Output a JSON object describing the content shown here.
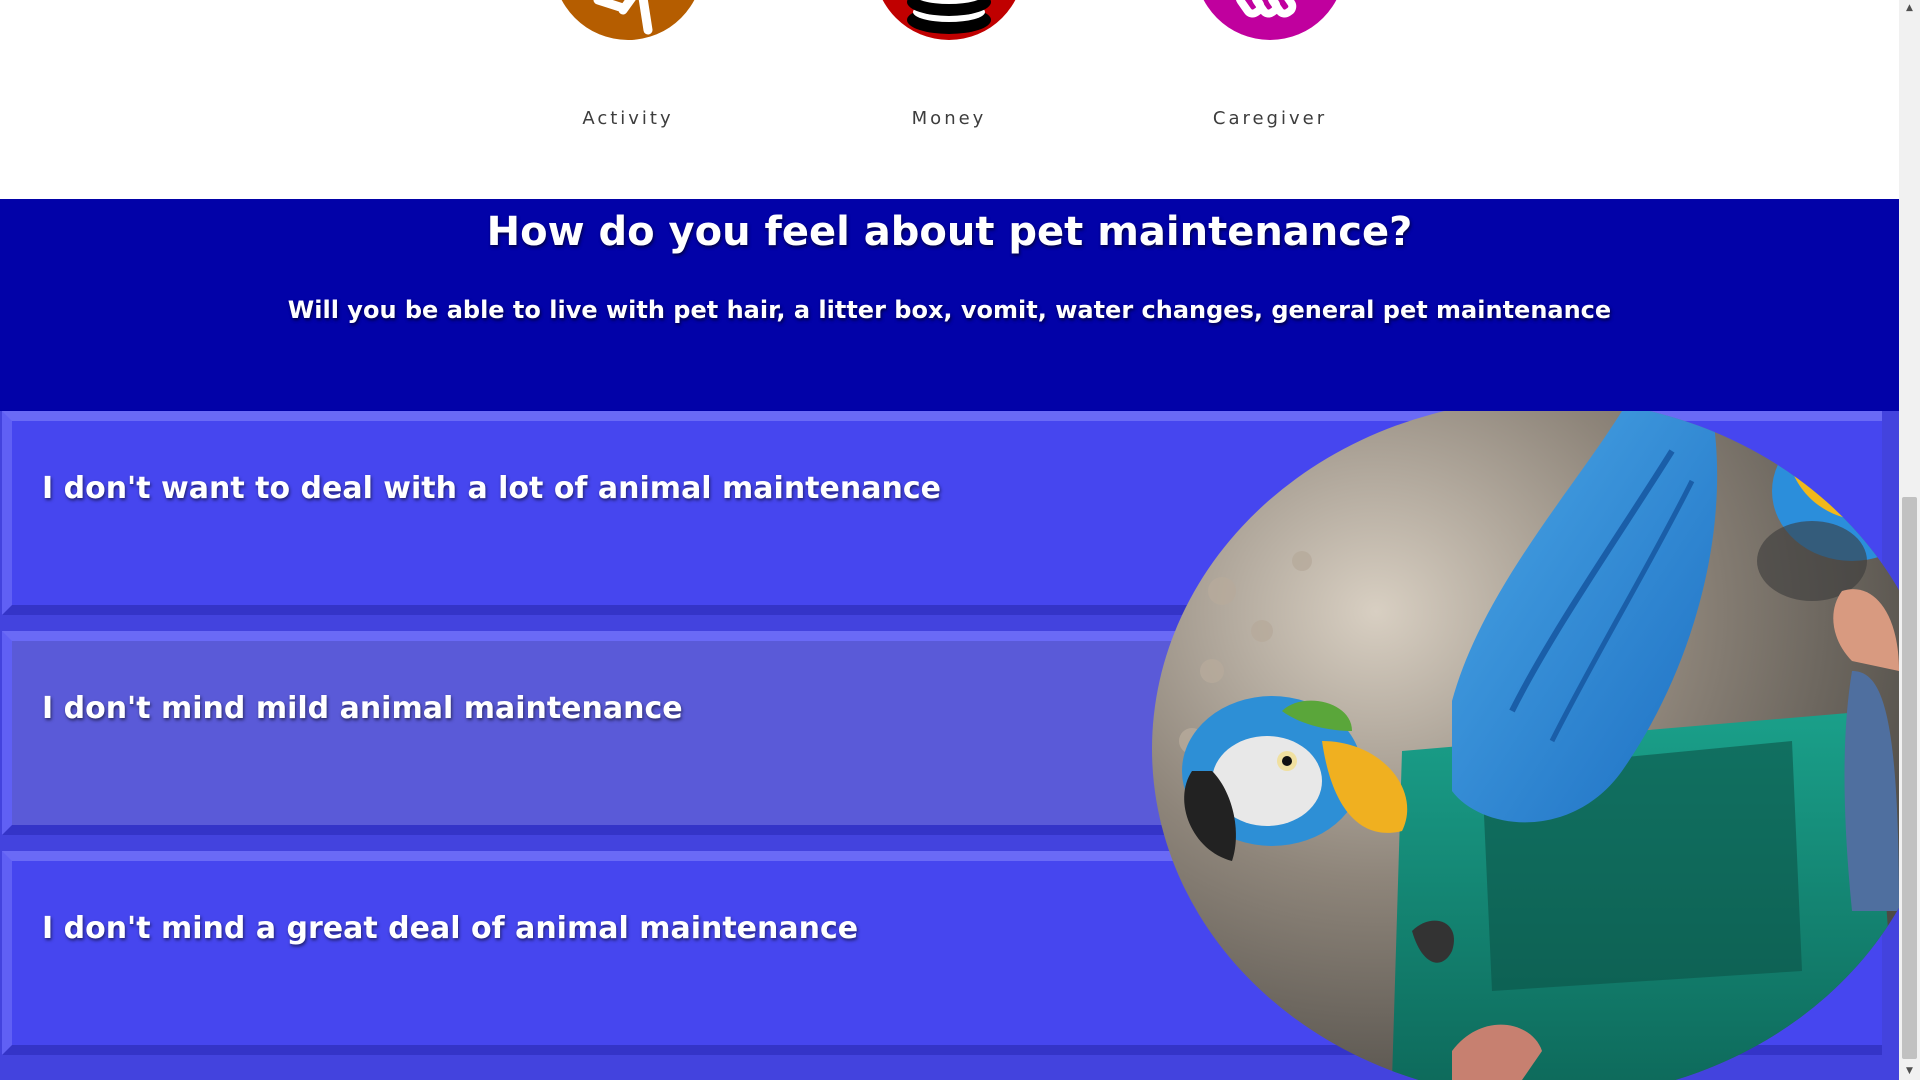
{
  "categories": [
    {
      "label": "Activity",
      "icon": "running-person-icon",
      "color": "#b55d00"
    },
    {
      "label": "Money",
      "icon": "coin-stack-icon",
      "color": "#c00000"
    },
    {
      "label": "Caregiver",
      "icon": "handshake-icon",
      "color": "#c0009e"
    }
  ],
  "question": {
    "title": "How do you feel about pet maintenance?",
    "subtitle": "Will you be able to live with pet hair, a litter box, vomit, water changes, general pet maintenance"
  },
  "options": [
    {
      "label": "I don't want to deal with a lot of animal maintenance"
    },
    {
      "label": "I don't mind mild animal maintenance"
    },
    {
      "label": "I don't mind a great deal of animal maintenance"
    }
  ],
  "colors": {
    "band": "#0202a8",
    "option": "#4646ef",
    "option_selected": "#5a5ad8"
  },
  "scrollbar": {
    "up_arrow": "▲",
    "down_arrow": "▼"
  }
}
